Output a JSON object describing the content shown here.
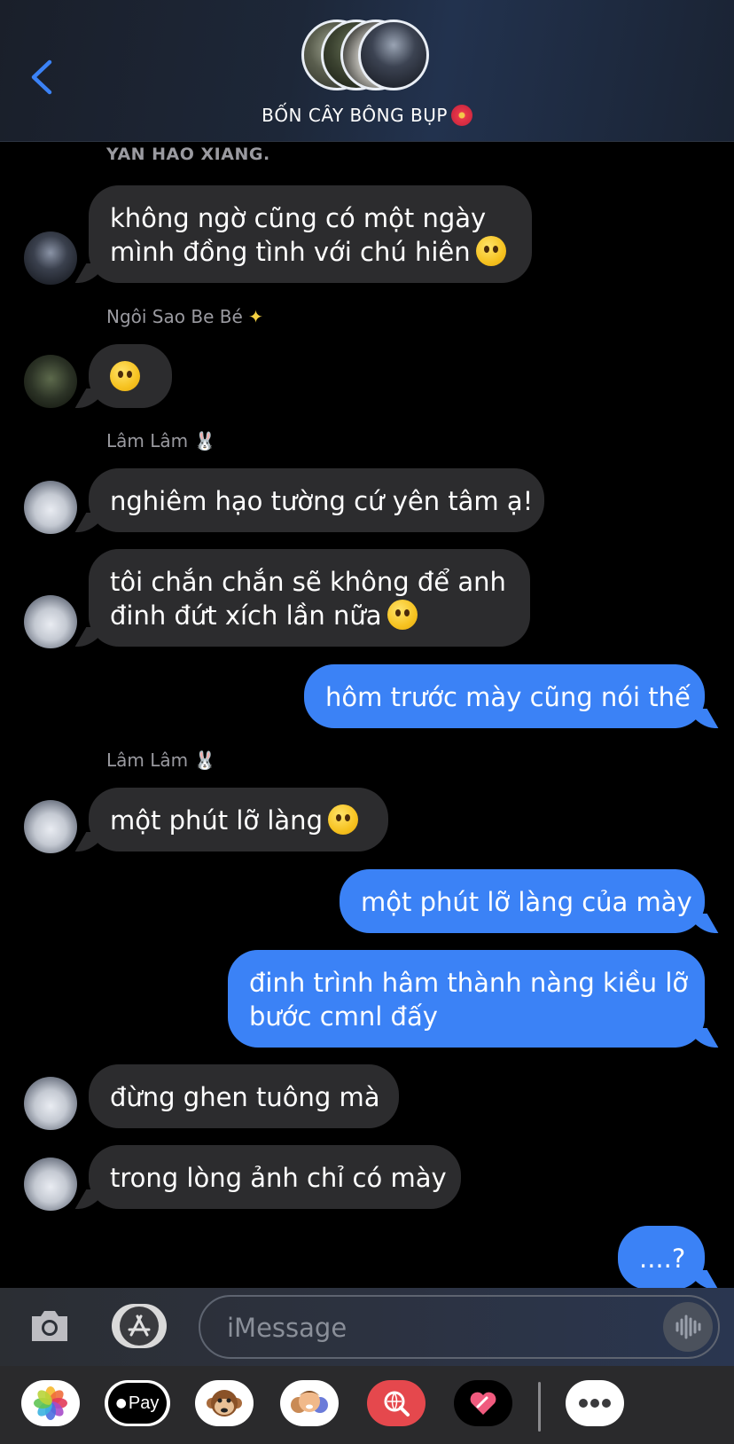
{
  "header": {
    "group_name": "BỐN CÂY BÔNG BỤP",
    "group_emoji": "hibiscus-icon"
  },
  "messages": [
    {
      "sender": "YAN HAO XIANG.",
      "direction": "in",
      "lines": [
        "không ngờ cũng có một ngày",
        "mình đồng tình với chú hiên"
      ],
      "emoji": "grinning-face-icon"
    },
    {
      "sender": "Ngôi Sao Be Bé",
      "sender_emoji": "sparkles-icon",
      "direction": "in",
      "emoji": "pleading-face-icon"
    },
    {
      "sender": "Lâm Lâm",
      "sender_emoji": "rabbit-face-icon",
      "direction": "in",
      "lines": [
        "nghiêm hạo tường cứ yên tâm ạ!"
      ]
    },
    {
      "direction": "in",
      "lines": [
        "tôi chắn chắn sẽ không để anh",
        "đinh đứt xích lần nữa"
      ],
      "emoji": "saluting-face-icon"
    },
    {
      "direction": "out",
      "lines": [
        "hôm trước mày cũng nói thế"
      ]
    },
    {
      "sender": "Lâm Lâm",
      "sender_emoji": "rabbit-face-icon",
      "direction": "in",
      "lines": [
        "một phút lỡ làng"
      ],
      "emoji": "pleading-face-icon"
    },
    {
      "direction": "out",
      "lines": [
        "một phút lỡ làng của mày"
      ]
    },
    {
      "direction": "out",
      "lines": [
        "đinh trình hâm thành nàng kiều lỡ",
        "bước cmnl đấy"
      ]
    },
    {
      "direction": "in",
      "lines": [
        "đừng ghen tuông mà"
      ]
    },
    {
      "direction": "in",
      "lines": [
        "trong lòng ảnh chỉ có mày"
      ]
    },
    {
      "direction": "out",
      "lines": [
        "....?"
      ]
    }
  ],
  "input": {
    "placeholder": "iMessage"
  },
  "drawer": {
    "apple_pay_label": "Pay",
    "apps": [
      "photos-icon",
      "apple-pay-icon",
      "monkey-animoji-icon",
      "memoji-icon",
      "web-search-icon",
      "digital-touch-icon",
      "more-icon"
    ]
  },
  "colors": {
    "incoming_bubble": "#2c2c2e",
    "outgoing_bubble": "#3b82f6",
    "accent": "#3b82f6"
  }
}
